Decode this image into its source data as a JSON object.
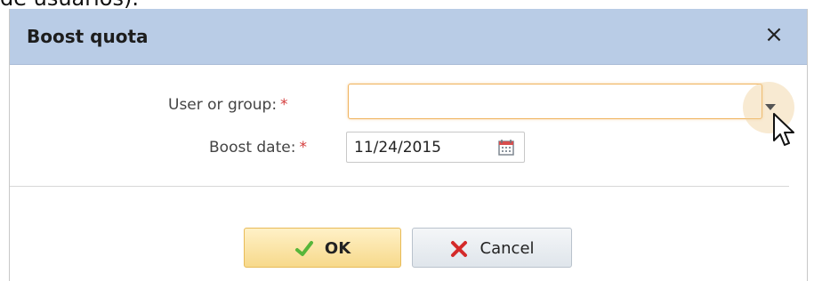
{
  "background": {
    "cut_text": "de usuarios)."
  },
  "dialog": {
    "title": "Boost quota",
    "close_symbol": "×",
    "fields": {
      "user_group_label": "User or group:",
      "required_mark": "*",
      "user_group_value": "",
      "boost_date_label": "Boost date:",
      "boost_date_value": "11/24/2015"
    },
    "buttons": {
      "ok": "OK",
      "cancel": "Cancel"
    }
  },
  "colors": {
    "titlebar": "#b9cce6",
    "focus_border": "#f0b35e",
    "ok_button": "#f7d98b",
    "required": "#d43c3c",
    "check_icon": "#57b63a",
    "cancel_icon": "#d42a2a"
  },
  "icons": {
    "close": "close-icon",
    "dropdown": "chevron-down-icon",
    "calendar": "calendar-icon",
    "ok": "check-icon",
    "cancel": "x-icon",
    "cursor": "mouse-pointer-icon"
  }
}
